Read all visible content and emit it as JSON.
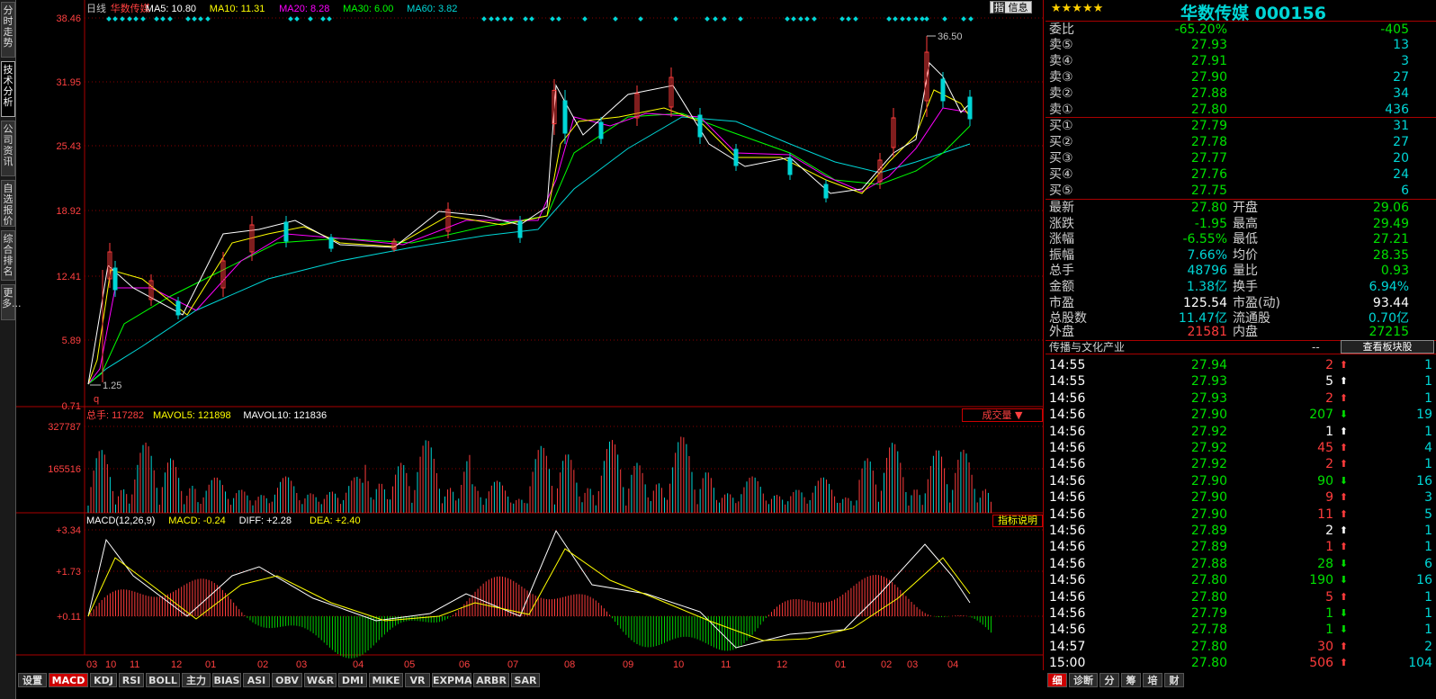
{
  "side_tabs": [
    "分时走势",
    "技术分析",
    "公司资讯",
    "自选报价",
    "综合排名",
    "更多..."
  ],
  "active_side_tab": "技术分析",
  "chart": {
    "mode": "日线",
    "name": "华数传媒",
    "ma": [
      {
        "label": "MA5: 10.80",
        "color": "#ffffff"
      },
      {
        "label": "MA10: 11.31",
        "color": "#ffff00"
      },
      {
        "label": "MA20: 8.28",
        "color": "#ff00ff"
      },
      {
        "label": "MA30: 6.00",
        "color": "#00ff00"
      },
      {
        "label": "MA60: 3.82",
        "color": "#00d6d6"
      }
    ],
    "info_button": "信息",
    "price_ticks": [
      "38.46",
      "31.95",
      "25.43",
      "18.92",
      "12.41",
      "5.89",
      "0.71"
    ],
    "high_mark": "36.50",
    "low_mark": "1.25",
    "q_mark": "q",
    "vol_legend": {
      "label": "总手: 117282",
      "mavol5": "MAVOL5: 121898",
      "mavol10": "MAVOL10: 121836"
    },
    "vol_selector": "成交量 ▼",
    "vol_ticks": [
      "327787",
      "165516"
    ],
    "macd_legend": {
      "label": "MACD(12,26,9)",
      "macd": "MACD: -0.24",
      "diff": "DIFF: +2.28",
      "dea": "DEA: +2.40"
    },
    "macd_help": "指标说明",
    "macd_ticks": [
      "+3.34",
      "+1.73",
      "+0.11"
    ],
    "months": [
      "03",
      "10",
      "11",
      "12",
      "01",
      "02",
      "03",
      "04",
      "05",
      "06",
      "07",
      "08",
      "09",
      "10",
      "11",
      "12",
      "01",
      "02",
      "03",
      "04",
      "05"
    ],
    "chart_data": {
      "type": "line",
      "x": [
        "03",
        "10",
        "11",
        "12",
        "01",
        "02",
        "03",
        "04",
        "05",
        "06",
        "07",
        "08",
        "09",
        "10",
        "11",
        "12",
        "01",
        "02",
        "03",
        "04",
        "05"
      ],
      "ylim": [
        0.71,
        38.46
      ],
      "series": [
        {
          "name": "MA5",
          "values": [
            1.25,
            12,
            11,
            10,
            13,
            17,
            16,
            15.5,
            15.8,
            17,
            17.5,
            28,
            28.5,
            29,
            25,
            23,
            21,
            22,
            26,
            33,
            29
          ]
        }
      ]
    }
  },
  "bottom_tabs": [
    "设置",
    "MACD",
    "KDJ",
    "RSI",
    "BOLL",
    "主力",
    "BIAS",
    "ASI",
    "OBV",
    "W&R",
    "DMI",
    "MIKE",
    "VR",
    "EXPMA",
    "ARBR",
    "SAR"
  ],
  "quote": {
    "stars": "★★★★★",
    "title": "华数传媒  000156",
    "weibi": {
      "label": "委比",
      "pct": "-65.20%",
      "val": "-405"
    },
    "sells": [
      {
        "l": "卖⑤",
        "p": "27.93",
        "v": "13"
      },
      {
        "l": "卖④",
        "p": "27.91",
        "v": "3"
      },
      {
        "l": "卖③",
        "p": "27.90",
        "v": "27"
      },
      {
        "l": "卖②",
        "p": "27.88",
        "v": "34"
      },
      {
        "l": "卖①",
        "p": "27.80",
        "v": "436"
      }
    ],
    "buys": [
      {
        "l": "买①",
        "p": "27.79",
        "v": "31"
      },
      {
        "l": "买②",
        "p": "27.78",
        "v": "27"
      },
      {
        "l": "买③",
        "p": "27.77",
        "v": "20"
      },
      {
        "l": "买④",
        "p": "27.76",
        "v": "24"
      },
      {
        "l": "买⑤",
        "p": "27.75",
        "v": "6"
      }
    ],
    "stats": [
      {
        "l1": "最新",
        "v1": "27.80",
        "c1": "green",
        "l2": "开盘",
        "v2": "29.06",
        "c2": "green"
      },
      {
        "l1": "涨跌",
        "v1": "-1.95",
        "c1": "green",
        "l2": "最高",
        "v2": "29.49",
        "c2": "green"
      },
      {
        "l1": "涨幅",
        "v1": "-6.55%",
        "c1": "green",
        "l2": "最低",
        "v2": "27.21",
        "c2": "green"
      },
      {
        "l1": "振幅",
        "v1": "7.66%",
        "c1": "cyan",
        "l2": "均价",
        "v2": "28.35",
        "c2": "green"
      },
      {
        "l1": "总手",
        "v1": "48796",
        "c1": "cyan",
        "l2": "量比",
        "v2": "0.93",
        "c2": "green"
      },
      {
        "l1": "金额",
        "v1": "1.38亿",
        "c1": "cyan",
        "l2": "换手",
        "v2": "6.94%",
        "c2": "cyan"
      },
      {
        "l1": "市盈",
        "v1": "125.54",
        "c1": "white",
        "l2": "市盈(动)",
        "v2": "93.44",
        "c2": "white"
      },
      {
        "l1": "总股数",
        "v1": "11.47亿",
        "c1": "cyan",
        "l2": "流通股",
        "v2": "0.70亿",
        "c2": "cyan"
      }
    ],
    "waipan": {
      "l1": "外盘",
      "v1": "21581",
      "l2": "内盘",
      "v2": "27215"
    },
    "sector": "传播与文化产业",
    "sector_dash": "--",
    "sector_btn": "查看板块股",
    "ticks": [
      {
        "t": "14:55",
        "p": "27.94",
        "v": "2",
        "d": "up",
        "n": "1"
      },
      {
        "t": "14:55",
        "p": "27.93",
        "v": "5",
        "d": "upw",
        "n": "1"
      },
      {
        "t": "14:56",
        "p": "27.93",
        "v": "2",
        "d": "up",
        "n": "1"
      },
      {
        "t": "14:56",
        "p": "27.90",
        "v": "207",
        "d": "down",
        "n": "19"
      },
      {
        "t": "14:56",
        "p": "27.92",
        "v": "1",
        "d": "upw",
        "n": "1"
      },
      {
        "t": "14:56",
        "p": "27.92",
        "v": "45",
        "d": "up",
        "n": "4"
      },
      {
        "t": "14:56",
        "p": "27.92",
        "v": "2",
        "d": "up",
        "n": "1"
      },
      {
        "t": "14:56",
        "p": "27.90",
        "v": "90",
        "d": "down",
        "n": "16"
      },
      {
        "t": "14:56",
        "p": "27.90",
        "v": "9",
        "d": "up",
        "n": "3"
      },
      {
        "t": "14:56",
        "p": "27.90",
        "v": "11",
        "d": "up",
        "n": "5"
      },
      {
        "t": "14:56",
        "p": "27.89",
        "v": "2",
        "d": "upw",
        "n": "1"
      },
      {
        "t": "14:56",
        "p": "27.89",
        "v": "1",
        "d": "up",
        "n": "1"
      },
      {
        "t": "14:56",
        "p": "27.88",
        "v": "28",
        "d": "down",
        "n": "6"
      },
      {
        "t": "14:56",
        "p": "27.80",
        "v": "190",
        "d": "down",
        "n": "16"
      },
      {
        "t": "14:56",
        "p": "27.80",
        "v": "5",
        "d": "up",
        "n": "1"
      },
      {
        "t": "14:56",
        "p": "27.79",
        "v": "1",
        "d": "down",
        "n": "1"
      },
      {
        "t": "14:56",
        "p": "27.78",
        "v": "1",
        "d": "down",
        "n": "1"
      },
      {
        "t": "14:57",
        "p": "27.80",
        "v": "30",
        "d": "up",
        "n": "2"
      },
      {
        "t": "15:00",
        "p": "27.80",
        "v": "506",
        "d": "up",
        "n": "104"
      }
    ],
    "bottom_tabs": [
      "细",
      "诊断",
      "分",
      "筹",
      "培",
      "财"
    ]
  }
}
